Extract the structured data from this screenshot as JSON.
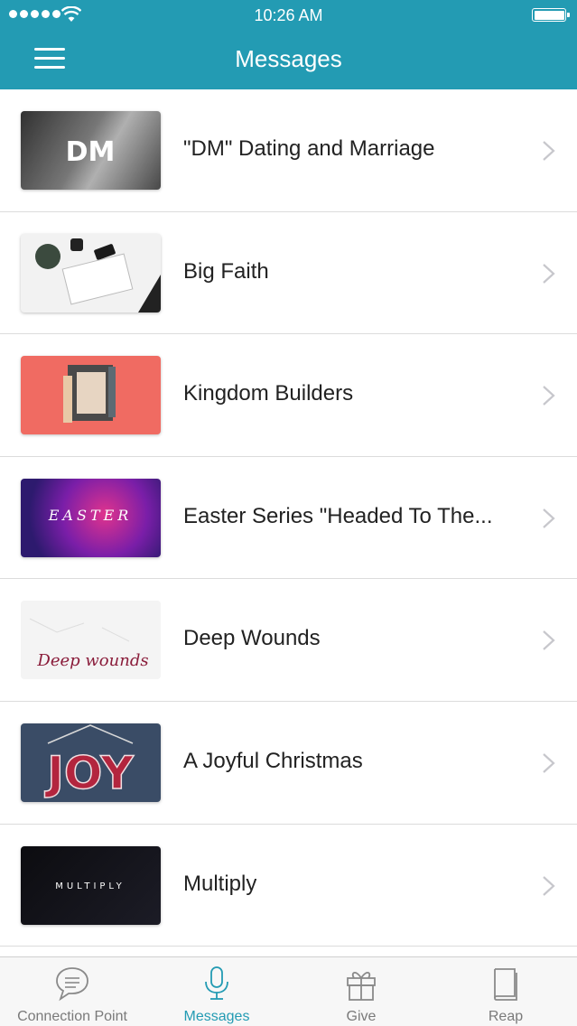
{
  "status_bar": {
    "time": "10:26 AM"
  },
  "header": {
    "title": "Messages"
  },
  "messages": [
    {
      "title": "\"DM\" Dating and Marriage",
      "thumb_text": "DM"
    },
    {
      "title": "Big Faith",
      "thumb_text": ""
    },
    {
      "title": "Kingdom Builders",
      "thumb_text": ""
    },
    {
      "title": "Easter Series \"Headed To The...",
      "thumb_text": "EASTER"
    },
    {
      "title": "Deep Wounds",
      "thumb_text": "Deep wounds"
    },
    {
      "title": "A Joyful Christmas",
      "thumb_text": "JOY"
    },
    {
      "title": "Multiply",
      "thumb_text": "MULTIPLY"
    }
  ],
  "tabs": [
    {
      "label": "Connection Point",
      "icon": "chat-bubble-icon",
      "active": false
    },
    {
      "label": "Messages",
      "icon": "microphone-icon",
      "active": true
    },
    {
      "label": "Give",
      "icon": "gift-icon",
      "active": false
    },
    {
      "label": "Reap",
      "icon": "book-icon",
      "active": false
    }
  ],
  "colors": {
    "accent": "#239bb3",
    "tab_inactive": "#7a7a7a"
  }
}
